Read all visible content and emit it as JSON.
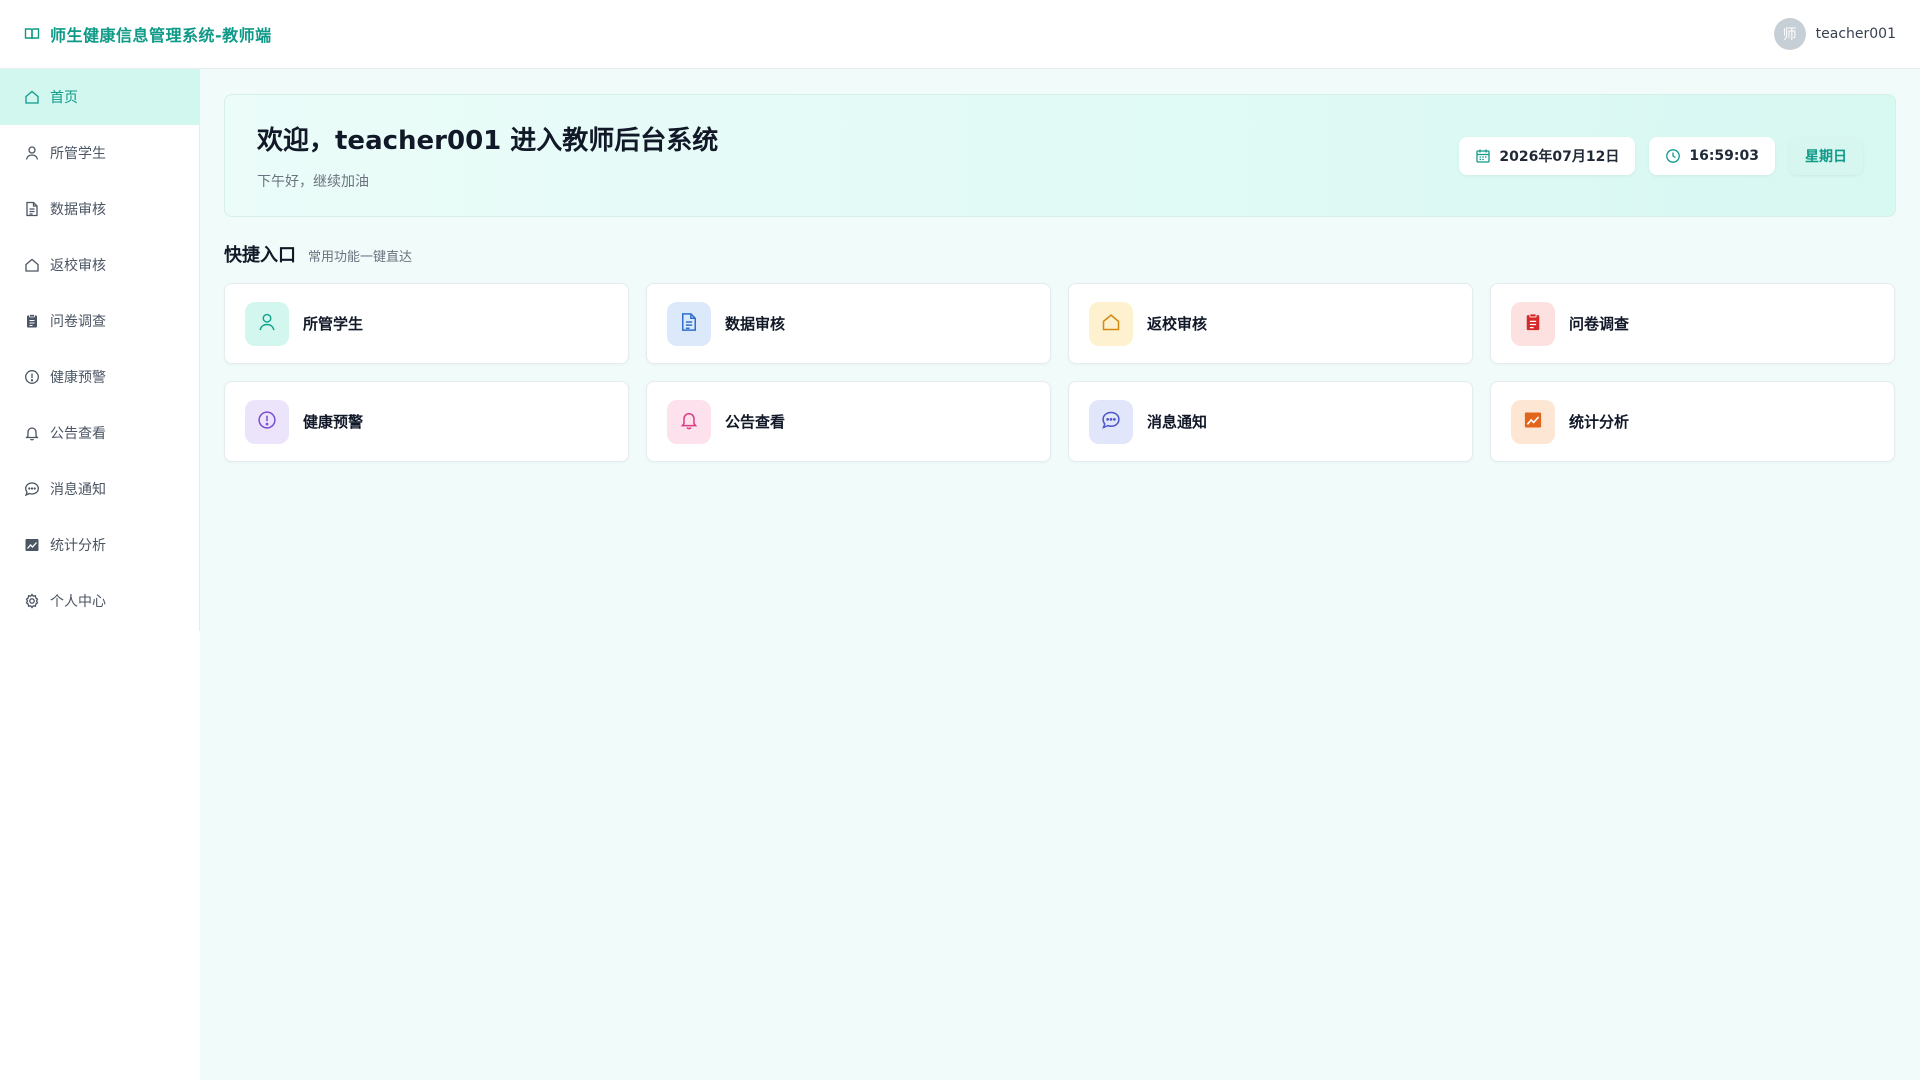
{
  "header": {
    "title": "师生健康信息管理系统-教师端",
    "avatar_text": "师",
    "username": "teacher001"
  },
  "sidebar": {
    "items": [
      {
        "label": "首页",
        "icon": "home-icon",
        "active": true
      },
      {
        "label": "所管学生",
        "icon": "user-icon"
      },
      {
        "label": "数据审核",
        "icon": "document-icon"
      },
      {
        "label": "返校审核",
        "icon": "home-outline-icon"
      },
      {
        "label": "问卷调查",
        "icon": "clipboard-icon"
      },
      {
        "label": "健康预警",
        "icon": "alert-icon"
      },
      {
        "label": "公告查看",
        "icon": "bell-icon"
      },
      {
        "label": "消息通知",
        "icon": "chat-icon"
      },
      {
        "label": "统计分析",
        "icon": "chart-icon"
      },
      {
        "label": "个人中心",
        "icon": "gear-icon"
      }
    ]
  },
  "welcome": {
    "title": "欢迎，teacher001 进入教师后台系统",
    "subtitle": "下午好，继续加油",
    "date": "2026年07月12日",
    "time": "16:59:03",
    "weekday": "星期日"
  },
  "quick": {
    "title": "快捷入口",
    "subtitle": "常用功能一键直达",
    "items": [
      {
        "label": "所管学生",
        "icon": "user-icon",
        "bg": "#d3f7ef",
        "fg": "#14a58f"
      },
      {
        "label": "数据审核",
        "icon": "document-icon",
        "bg": "#dbe9fb",
        "fg": "#2f6fca"
      },
      {
        "label": "返校审核",
        "icon": "home-outline-icon",
        "bg": "#fdf1cf",
        "fg": "#d6890f"
      },
      {
        "label": "问卷调查",
        "icon": "clipboard-icon",
        "bg": "#fde1e1",
        "fg": "#d62a2a"
      },
      {
        "label": "健康预警",
        "icon": "alert-icon",
        "bg": "#ece4fb",
        "fg": "#7b4fd0"
      },
      {
        "label": "公告查看",
        "icon": "bell-icon",
        "bg": "#fde2ee",
        "fg": "#db3c80"
      },
      {
        "label": "消息通知",
        "icon": "chat-icon",
        "bg": "#e2e6fb",
        "fg": "#4b57c9"
      },
      {
        "label": "统计分析",
        "icon": "chart-icon",
        "bg": "#fde6d3",
        "fg": "#e2651c"
      }
    ]
  },
  "colors": {
    "accent": "#0f9a88",
    "background": "#f1fbf9"
  }
}
